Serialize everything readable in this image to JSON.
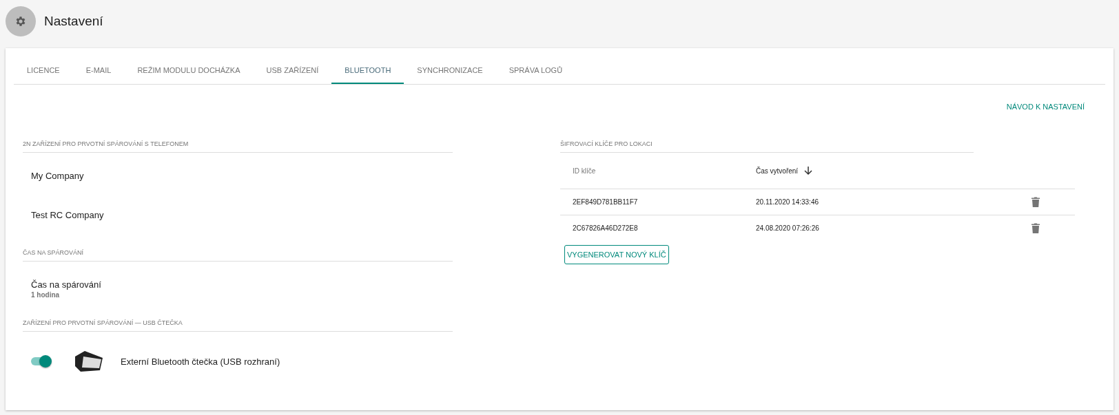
{
  "page": {
    "title": "Nastavení"
  },
  "tabs": [
    {
      "label": "LICENCE",
      "selected": false
    },
    {
      "label": "E-MAIL",
      "selected": false
    },
    {
      "label": "REŽIM MODULU DOCHÁZKA",
      "selected": false
    },
    {
      "label": "USB ZAŘÍZENÍ",
      "selected": false
    },
    {
      "label": "BLUETOOTH",
      "selected": true
    },
    {
      "label": "SYNCHRONIZACE",
      "selected": false
    },
    {
      "label": "SPRÁVA LOGŮ",
      "selected": false
    }
  ],
  "guide_link": "NÁVOD K NASTAVENÍ",
  "pairing_devices": {
    "heading": "2N ZAŘÍZENÍ PRO PRVOTNÍ SPÁROVÁNÍ S TELEFONEM",
    "items": [
      "My Company",
      "Test RC Company"
    ]
  },
  "pairing_time": {
    "heading": "ČAS NA SPÁROVÁNÍ",
    "label": "Čas na spárování",
    "value": "1 hodina"
  },
  "usb_reader": {
    "heading": "ZAŘÍZENÍ PRO PRVOTNÍ SPÁROVÁNÍ — USB ČTEČKA",
    "on": true,
    "label": "Externí Bluetooth čtečka (USB rozhraní)"
  },
  "keys": {
    "heading": "ŠIFROVACÍ KLÍČE PRO LOKACI",
    "columns": [
      {
        "label": "ID klíče",
        "sorted": false
      },
      {
        "label": "Čas vytvoření",
        "sorted": true
      }
    ],
    "rows": [
      {
        "id": "2EF849D781BB11F7",
        "created": "20.11.2020 14:33:46"
      },
      {
        "id": "2C67826A46D272E8",
        "created": "24.08.2020 07:26:26"
      }
    ],
    "button": "VYGENEROVAT NOVÝ KLÍČ"
  }
}
